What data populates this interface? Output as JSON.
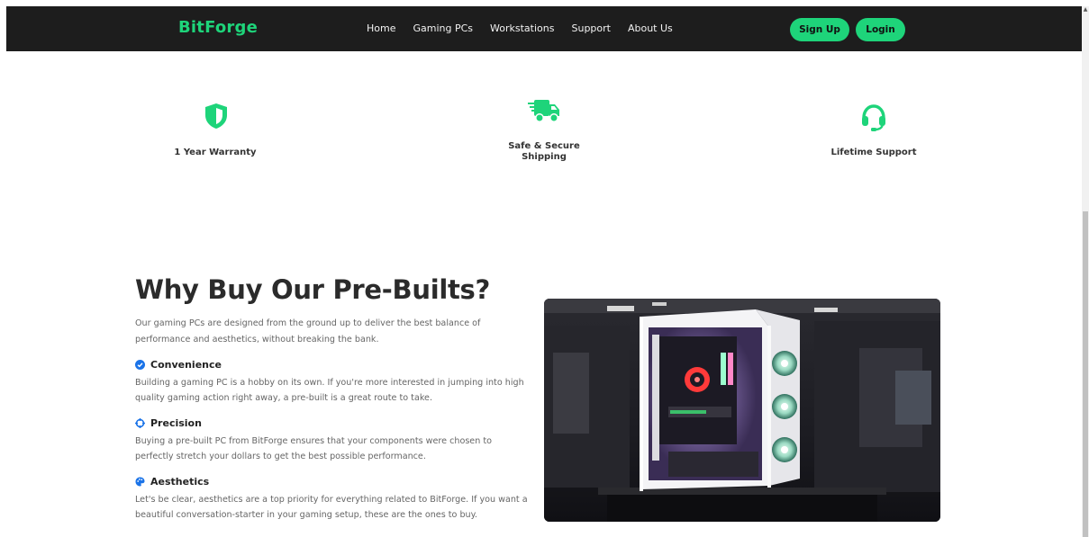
{
  "nav": {
    "brand": "BitForge",
    "links": [
      "Home",
      "Gaming PCs",
      "Workstations",
      "Support",
      "About Us"
    ],
    "signup_label": "Sign Up",
    "login_label": "Login"
  },
  "features": [
    {
      "icon": "shield-icon",
      "label": "1 Year Warranty"
    },
    {
      "icon": "truck-icon",
      "label_line1": "Safe & Secure",
      "label_line2": "Shipping"
    },
    {
      "icon": "headset-icon",
      "label": "Lifetime Support"
    }
  ],
  "why": {
    "title": "Why Buy Our Pre-Builts?",
    "intro": "Our gaming PCs are designed from the ground up to deliver the best balance of performance and aesthetics, without breaking the bank.",
    "points": [
      {
        "icon": "check-circle-icon",
        "title": "Convenience",
        "text": "Building a gaming PC is a hobby on its own. If you're more interested in jumping into high quality gaming action right away, a pre-built is a great route to take."
      },
      {
        "icon": "crosshair-icon",
        "title": "Precision",
        "text": "Buying a pre-built PC from BitForge ensures that your components were chosen to perfectly stretch your dollars to get the best possible performance."
      },
      {
        "icon": "palette-icon",
        "title": "Aesthetics",
        "text": "Let's be clear, aesthetics are a top priority for everything related to BitForge. If you want a beautiful conversation-starter in your gaming setup, these are the ones to buy."
      }
    ]
  },
  "colors": {
    "accent": "#1ed47a",
    "navbar": "#1d1d1d",
    "point_icon": "#1a73e8"
  }
}
